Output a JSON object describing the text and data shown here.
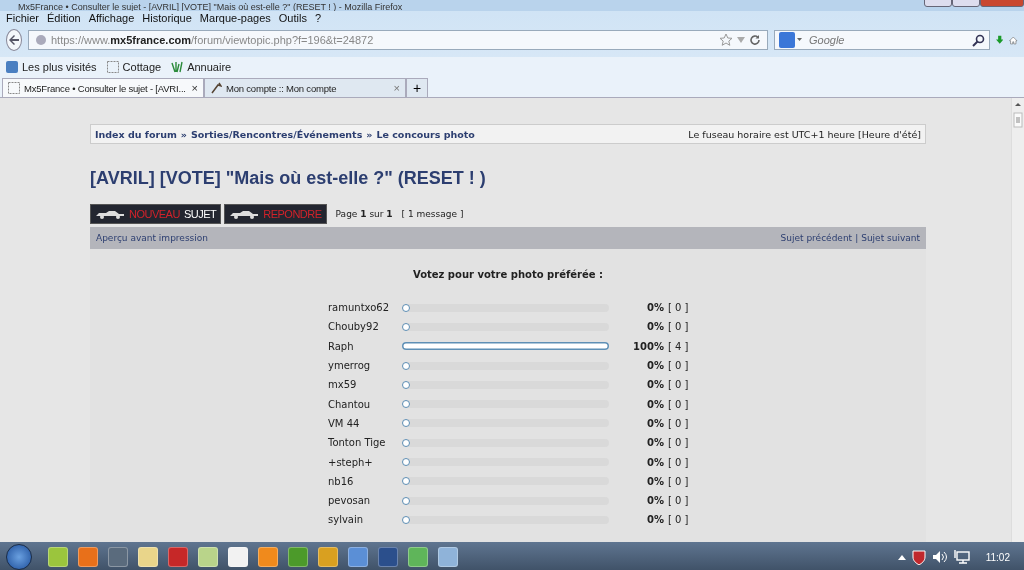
{
  "window": {
    "title": "Mx5France • Consulter le sujet - [AVRIL] [VOTE] \"Mais où est-elle ?\" (RESET ! ) - Mozilla Firefox"
  },
  "menu": [
    "Fichier",
    "Édition",
    "Affichage",
    "Historique",
    "Marque-pages",
    "Outils",
    "?"
  ],
  "address_bar": {
    "url": "https://www.**mx5france.com**/forum/viewtopic.php?f=196&t=24872"
  },
  "search": {
    "placeholder": "Google"
  },
  "bookmarks": [
    "Les plus visités",
    "Cottage",
    "Annuaire"
  ],
  "tabs": [
    {
      "label": "Mx5France • Consulter le sujet - [AVRI...",
      "close": "×",
      "selected": true
    },
    {
      "label": "Mon compte :: Mon compte",
      "close": "×",
      "selected": false
    }
  ],
  "new_tab": "+",
  "breadcrumb": [
    "Index du forum",
    "»",
    "Sorties/Rencontres/Événements",
    "»",
    "Le concours photo"
  ],
  "timezone": "Le fuseau horaire est UTC+1 heure [Heure d'été]",
  "topic_title": "[AVRIL] [VOTE] \"Mais où est-elle ?\" (RESET ! )",
  "new_topic_button": {
    "highlight": "NOUVEAU",
    "rest": "SUJET"
  },
  "reply_button": {
    "label": "REPONDRE"
  },
  "pagination": "Page **1** sur **1**",
  "message_count": "[ 1 message ]",
  "print_link": "Aperçu avant impression",
  "prev_topic": "Sujet précédent",
  "separator": "|",
  "next_topic": "Sujet suivant",
  "poll": {
    "question": "Votez pour votre photo préférée :",
    "options": [
      {
        "name": "ramuntxo62",
        "level": 0,
        "percent": "0%",
        "count": "[ 0 ]"
      },
      {
        "name": "Chouby92",
        "level": 0,
        "percent": "0%",
        "count": "[ 0 ]"
      },
      {
        "name": "Raph",
        "level": 1,
        "percent": "100%",
        "count": "[ 4 ]"
      },
      {
        "name": "ymerrog",
        "level": 0,
        "percent": "0%",
        "count": "[ 0 ]"
      },
      {
        "name": "mx59",
        "level": 0,
        "percent": "0%",
        "count": "[ 0 ]"
      },
      {
        "name": "Chantou",
        "level": 0,
        "percent": "0%",
        "count": "[ 0 ]"
      },
      {
        "name": "VM 44",
        "level": 0,
        "percent": "0%",
        "count": "[ 0 ]"
      },
      {
        "name": "Tonton Tige",
        "level": 0,
        "percent": "0%",
        "count": "[ 0 ]"
      },
      {
        "name": "+steph+",
        "level": 0,
        "percent": "0%",
        "count": "[ 0 ]"
      },
      {
        "name": "nb16",
        "level": 0,
        "percent": "0%",
        "count": "[ 0 ]"
      },
      {
        "name": "pevosan",
        "level": 0,
        "percent": "0%",
        "count": "[ 0 ]"
      },
      {
        "name": "sylvain",
        "level": 0,
        "percent": "0%",
        "count": "[ 0 ]"
      }
    ]
  },
  "taskbar": {
    "apps": [
      {
        "color": "#9bc53d"
      },
      {
        "color": "#e8701a"
      },
      {
        "color": "#5a6b7d"
      },
      {
        "color": "#e9d58a"
      },
      {
        "color": "#c62828"
      },
      {
        "color": "#b9d48a"
      },
      {
        "color": "#f2f2f2"
      },
      {
        "color": "#f08a1c"
      },
      {
        "color": "#4c9a2a"
      },
      {
        "color": "#d9a020"
      },
      {
        "color": "#5b8fd6"
      },
      {
        "color": "#2b4f8c"
      },
      {
        "color": "#5fb55a"
      },
      {
        "color": "#8fb3d9"
      }
    ],
    "clock": "11:02"
  }
}
